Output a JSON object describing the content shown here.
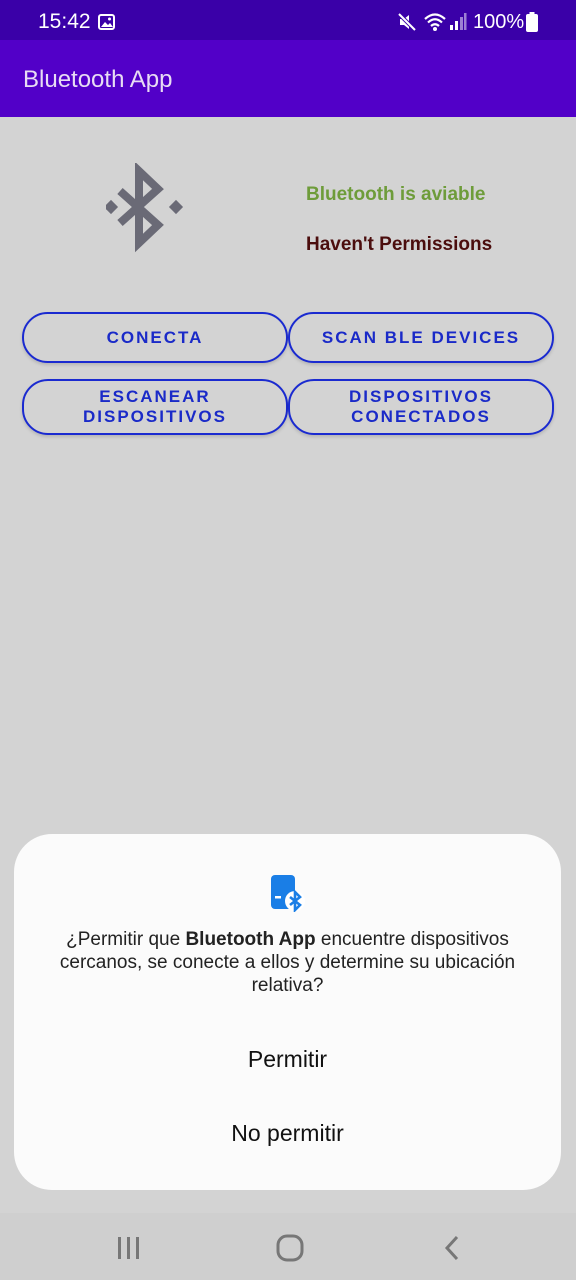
{
  "status_bar": {
    "time": "15:42",
    "battery": "100%",
    "icons": [
      "gallery-icon",
      "mute-icon",
      "wifi-icon",
      "signal-icon",
      "battery-icon"
    ]
  },
  "app_bar": {
    "title": "Bluetooth App"
  },
  "main": {
    "bluetooth_status": "Bluetooth is aviable",
    "permission_status": "Haven't Permissions",
    "buttons": {
      "conecta": "CONECTA",
      "scan_ble": "SCAN BLE DEVICES",
      "escanear": "ESCANEAR DISPOSITIVOS",
      "conectados": "DISPOSITIVOS CONECTADOS"
    }
  },
  "dialog": {
    "message_prefix": "¿Permitir que ",
    "message_app": "Bluetooth App",
    "message_suffix": " encuentre dispositivos cercanos, se conecte a ellos y determine su ubicación relativa?",
    "allow": "Permitir",
    "deny": "No permitir"
  },
  "nav_bar": {
    "icons": [
      "recents-icon",
      "home-icon",
      "back-icon"
    ]
  },
  "colors": {
    "status_bar": "#3a00a8",
    "app_bar": "#5200c8",
    "button_accent": "#1a2ad0",
    "available": "#6e9c3a",
    "no_permission": "#4b0d0d"
  }
}
